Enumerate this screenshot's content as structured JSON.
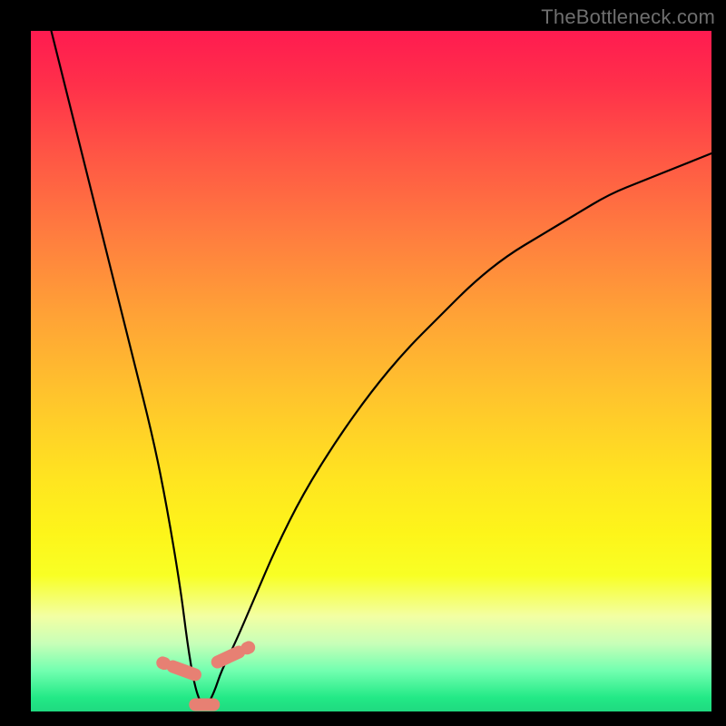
{
  "watermark": "TheBottleneck.com",
  "colors": {
    "frame": "#000000",
    "gradient_top": "#ff1b50",
    "gradient_mid": "#ffe520",
    "gradient_bottom": "#1fda80",
    "curve": "#000000",
    "blob": "#e78073"
  },
  "chart_data": {
    "type": "line",
    "title": "",
    "xlabel": "",
    "ylabel": "",
    "xlim": [
      0,
      100
    ],
    "ylim": [
      0,
      100
    ],
    "grid": false,
    "legend": false,
    "note": "x and y in percent of plot area; y=0 at bottom (best/green), y=100 at top (worst/red). V-shaped bottleneck curve with minimum near x≈25.",
    "series": [
      {
        "name": "bottleneck-curve",
        "x": [
          3,
          6,
          9,
          12,
          15,
          18,
          20,
          22,
          23,
          24,
          25,
          26,
          27,
          28,
          30,
          33,
          36,
          40,
          45,
          50,
          55,
          60,
          65,
          70,
          75,
          80,
          85,
          90,
          95,
          100
        ],
        "y": [
          100,
          88,
          76,
          64,
          52,
          40,
          30,
          18,
          10,
          4,
          1,
          1,
          3,
          6,
          10,
          17,
          24,
          32,
          40,
          47,
          53,
          58,
          63,
          67,
          70,
          73,
          76,
          78,
          80,
          82
        ]
      }
    ],
    "markers": [
      {
        "name": "cluster-left",
        "shape": "capsule",
        "x": 22.5,
        "y": 6,
        "note": "salmon marker on descending arm"
      },
      {
        "name": "cluster-min",
        "shape": "capsule",
        "x": 25.5,
        "y": 1,
        "note": "salmon marker at trough"
      },
      {
        "name": "cluster-right",
        "shape": "capsule",
        "x": 29.0,
        "y": 8,
        "note": "salmon marker on ascending arm"
      }
    ]
  }
}
